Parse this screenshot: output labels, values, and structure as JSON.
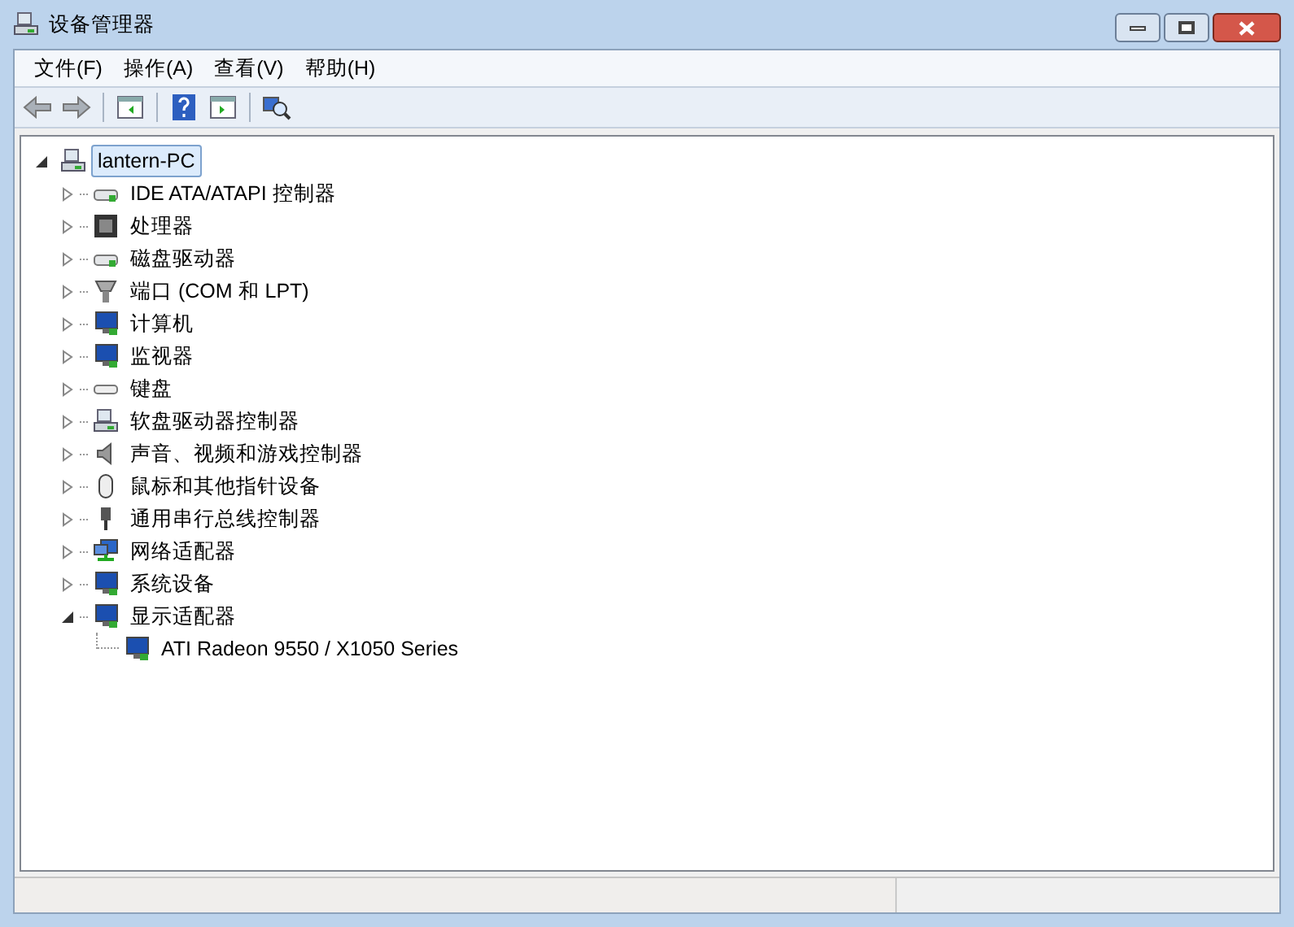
{
  "window": {
    "title": "设备管理器"
  },
  "menu": [
    "文件(F)",
    "操作(A)",
    "查看(V)",
    "帮助(H)"
  ],
  "tree": {
    "label": "lantern-PC",
    "expanded": true,
    "selected": true,
    "children": [
      {
        "label": "IDE ATA/ATAPI 控制器",
        "expanded": false,
        "selected": false
      },
      {
        "label": "处理器",
        "expanded": false,
        "selected": false
      },
      {
        "label": "磁盘驱动器",
        "expanded": false,
        "selected": false
      },
      {
        "label": "端口 (COM 和 LPT)",
        "expanded": false,
        "selected": false
      },
      {
        "label": "计算机",
        "expanded": false,
        "selected": false
      },
      {
        "label": "监视器",
        "expanded": false,
        "selected": false
      },
      {
        "label": "键盘",
        "expanded": false,
        "selected": false
      },
      {
        "label": "软盘驱动器控制器",
        "expanded": false,
        "selected": false
      },
      {
        "label": "声音、视频和游戏控制器",
        "expanded": false,
        "selected": false
      },
      {
        "label": "鼠标和其他指针设备",
        "expanded": false,
        "selected": false
      },
      {
        "label": "通用串行总线控制器",
        "expanded": false,
        "selected": false
      },
      {
        "label": "网络适配器",
        "expanded": false,
        "selected": false
      },
      {
        "label": "系统设备",
        "expanded": false,
        "selected": false
      },
      {
        "label": "显示适配器",
        "expanded": true,
        "selected": false,
        "children": [
          {
            "label": "ATI Radeon 9550 / X1050 Series",
            "selected": false
          }
        ]
      }
    ]
  }
}
